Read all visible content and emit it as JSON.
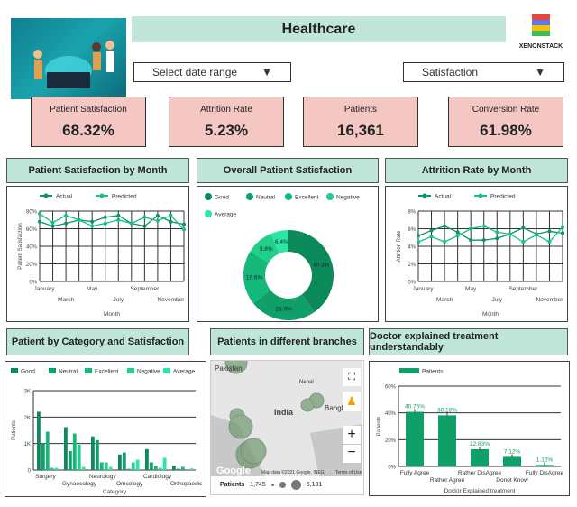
{
  "header": {
    "title": "Healthcare",
    "logo_text": "XENONSTACK"
  },
  "filters": {
    "date_range": "Select date range",
    "metric": "Satisfaction"
  },
  "kpis": [
    {
      "label": "Patient Satisfaction",
      "value": "68.32%"
    },
    {
      "label": "Attrition Rate",
      "value": "5.23%"
    },
    {
      "label": "Patients",
      "value": "16,361"
    },
    {
      "label": "Conversion Rate",
      "value": "61.98%"
    }
  ],
  "sections": {
    "sat_month": "Patient Satisfaction by Month",
    "overall": "Overall Patient Satisfaction",
    "attr_month": "Attrition Rate by Month",
    "category": "Patient by Category and Satisfaction",
    "branches": "Patients in different branches",
    "doctor": "Doctor explained treatment understandably"
  },
  "colors": {
    "good": "#0b8a5a",
    "neutral": "#0fa06a",
    "excellent": "#14b97a",
    "negative": "#1fcf8a",
    "average": "#2de6a6",
    "actual": "#0b9463",
    "predicted": "#14c184",
    "header": "#bfe6d8",
    "kpi": "#f4c7c3"
  },
  "map": {
    "labels": [
      "Pakistan",
      "Nepal",
      "India",
      "Bangl",
      "Bh"
    ],
    "attribution": "Map data ©2021 Google, INEGI",
    "terms": "Terms of Use",
    "google": "Google",
    "legend_label": "Patients",
    "legend_min": "1,745",
    "legend_max": "5,181"
  },
  "chart_data": [
    {
      "type": "line",
      "title": "Patient Satisfaction by Month",
      "xlabel": "Month",
      "ylabel": "Patient Satisfaction",
      "ylim": [
        0,
        80
      ],
      "yticks": [
        "0%",
        "20%",
        "40%",
        "60%",
        "80%"
      ],
      "x": [
        "January",
        "February",
        "March",
        "April",
        "May",
        "June",
        "July",
        "August",
        "September",
        "October",
        "November",
        "December"
      ],
      "xtick_labels": [
        "January",
        "March",
        "May",
        "July",
        "September",
        "November"
      ],
      "legend": "top",
      "grid": true,
      "series": [
        {
          "name": "Actual",
          "values": [
            68,
            63,
            66,
            70,
            68,
            73,
            75,
            66,
            63,
            75,
            68,
            65
          ]
        },
        {
          "name": "Predicted",
          "values": [
            77,
            67,
            75,
            70,
            63,
            66,
            70,
            66,
            73,
            69,
            75,
            59
          ]
        }
      ]
    },
    {
      "type": "pie",
      "title": "Overall Patient Satisfaction",
      "donut": true,
      "legend": "top",
      "labels": [
        "Good",
        "Neutral",
        "Excellent",
        "Negative",
        "Average"
      ],
      "values": [
        40.3,
        23.9,
        19.6,
        9.8,
        6.4
      ],
      "value_labels": [
        "40.3%",
        "23.9%",
        "19.6%",
        "9.8%",
        "6.4%"
      ]
    },
    {
      "type": "line",
      "title": "Attrition Rate by Month",
      "xlabel": "Month",
      "ylabel": "Attrition Rate",
      "ylim": [
        0,
        8
      ],
      "yticks": [
        "0%",
        "2%",
        "4%",
        "6%",
        "8%"
      ],
      "x": [
        "January",
        "February",
        "March",
        "April",
        "May",
        "June",
        "July",
        "August",
        "September",
        "October",
        "November",
        "December"
      ],
      "xtick_labels": [
        "January",
        "March",
        "May",
        "July",
        "September",
        "November"
      ],
      "legend": "top",
      "grid": true,
      "series": [
        {
          "name": "Actual",
          "values": [
            5.2,
            5.8,
            6.3,
            5.6,
            4.7,
            4.7,
            4.9,
            5.4,
            6.1,
            5.4,
            5.7,
            5.5
          ]
        },
        {
          "name": "Predicted",
          "values": [
            4.5,
            5.1,
            4.5,
            5.2,
            6.0,
            6.3,
            5.6,
            5.4,
            4.5,
            5.3,
            4.5,
            6.2
          ]
        }
      ]
    },
    {
      "type": "bar",
      "title": "Patient by Category and Satisfaction",
      "xlabel": "Category",
      "ylabel": "Patients",
      "ylim": [
        0,
        3000
      ],
      "yticks": [
        "0",
        "1K",
        "2K",
        "3K"
      ],
      "legend": "top",
      "grid": true,
      "categories": [
        "Surgery",
        "Gynaecology",
        "Neurology",
        "Omcology",
        "Cardiology",
        "Orthopaedis"
      ],
      "series": [
        {
          "name": "Good",
          "values": [
            2200,
            1620,
            1270,
            590,
            790,
            160
          ]
        },
        {
          "name": "Neutral",
          "values": [
            1000,
            720,
            1130,
            660,
            290,
            50
          ]
        },
        {
          "name": "Excellent",
          "values": [
            1450,
            1380,
            290,
            50,
            160,
            120
          ]
        },
        {
          "name": "Negative",
          "values": [
            80,
            960,
            290,
            290,
            80,
            0
          ]
        },
        {
          "name": "Average",
          "values": [
            80,
            120,
            120,
            390,
            460,
            60
          ]
        }
      ]
    },
    {
      "type": "bar",
      "title": "Doctor explained treatment understandably",
      "xlabel": "Doctor Explained treatment",
      "ylabel": "Patients",
      "ylim": [
        0,
        60
      ],
      "yticks": [
        "0%",
        "20%",
        "40%",
        "60%"
      ],
      "legend": "top",
      "grid": true,
      "categories": [
        "Fully Agree",
        "Rather Agree",
        "Rather DisAgree",
        "Donot Know",
        "Fully DisAgree"
      ],
      "series": [
        {
          "name": "Patients",
          "values": [
            40.75,
            38.18,
            12.83,
            7.12,
            1.12
          ]
        }
      ],
      "value_labels": [
        "40.75%",
        "38.18%",
        "12.83%",
        "7.12%",
        "1.12%"
      ]
    }
  ]
}
